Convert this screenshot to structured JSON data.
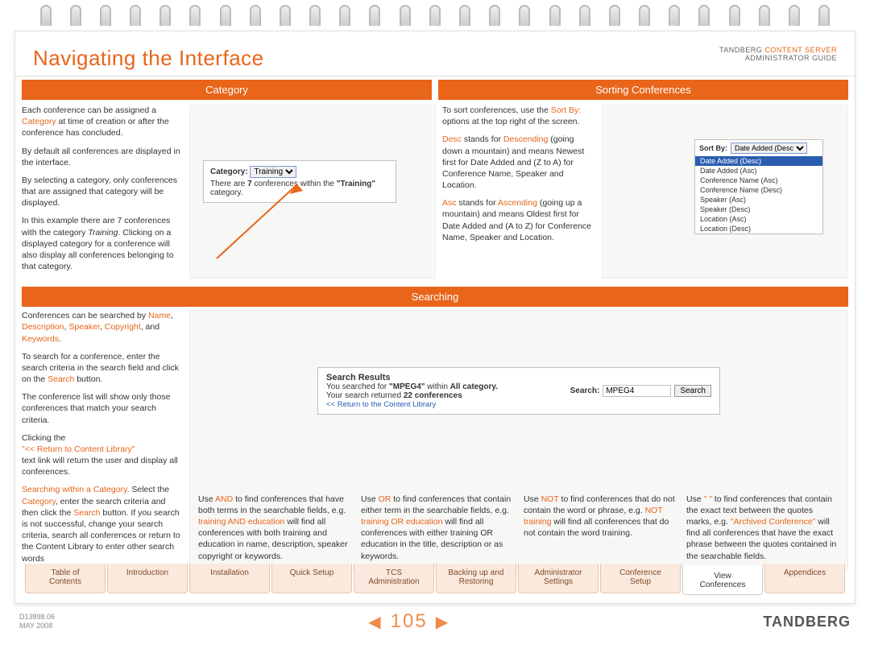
{
  "header": {
    "title": "Navigating the Interface",
    "brand_line1_a": "TANDBERG ",
    "brand_line1_b": "CONTENT SERVER",
    "brand_line2": "ADMINISTRATOR GUIDE"
  },
  "bars": {
    "category": "Category",
    "sorting": "Sorting Conferences",
    "searching": "Searching"
  },
  "category": {
    "p1a": "Each conference can be assigned a ",
    "p1b": "Category",
    "p1c": " at time of creation or after the conference has concluded.",
    "p2": "By default all conferences are displayed in the interface.",
    "p3": "By selecting a category, only conferences that are assigned that category will be displayed.",
    "p4a": "In this example there are 7 conferences with the category ",
    "p4b": "Training",
    "p4c": ". Clicking on a displayed category for a conference will also display all conferences belonging to that category.",
    "box_label": "Category:",
    "box_select": "Training",
    "box_sub_a": "There are ",
    "box_sub_b": "7",
    "box_sub_c": " conferences within the ",
    "box_sub_d": "\"Training\"",
    "box_sub_e": " category."
  },
  "sorting": {
    "p1a": "To sort conferences, use the ",
    "p1b": "Sort By:",
    "p1c": " options at the top right of the screen.",
    "p2a": "Desc",
    "p2b": " stands for ",
    "p2c": "Descending",
    "p2d": " (going down a mountain) and means Newest first for Date Added and (Z to A) for Conference Name, Speaker and Location.",
    "p3a": "Asc",
    "p3b": " stands for ",
    "p3c": "Ascending",
    "p3d": " (going up a mountain) and means Oldest first for Date Added and (A to Z) for Conference Name, Speaker and Location.",
    "box_label": "Sort By:",
    "box_selected": "Date Added (Desc)",
    "options": [
      "Date Added (Desc)",
      "Date Added (Asc)",
      "Conference Name (Asc)",
      "Conference Name (Desc)",
      "Speaker (Asc)",
      "Speaker (Desc)",
      "Location (Asc)",
      "Location (Desc)"
    ]
  },
  "searching": {
    "left": {
      "p1a": "Conferences can be searched by ",
      "p1b": "Name",
      "p1c": ", ",
      "p1d": "Description",
      "p1e": ", ",
      "p1f": "Speaker",
      "p1g": ", ",
      "p1h": "Copyright",
      "p1i": ", and ",
      "p1j": "Keywords",
      "p1k": ".",
      "p2a": "To search for a conference, enter the search criteria in the search field and click on the ",
      "p2b": "Search",
      "p2c": " button.",
      "p3": "The conference list will show only those conferences that match your search criteria.",
      "p4a": "Clicking the",
      "p4b": "\"<< Return to Content Library\"",
      "p4c": "text link will return the user and display all conferences.",
      "p5a": "Searching within a Category",
      "p5b": ". Select the ",
      "p5c": "Category",
      "p5d": ", enter the search criteria and then click the ",
      "p5e": "Search",
      "p5f": " button. If you search is not successful, change your search criteria, search all conferences or return to the Content Library to enter other search words"
    },
    "results": {
      "title": "Search Results",
      "line1a": "You searched for ",
      "line1b": "\"MPEG4\"",
      "line1c": " within ",
      "line1d": "All category.",
      "line2a": "Your search returned ",
      "line2b": "22 conferences",
      "return_link": "<< Return to the Content Library",
      "search_label": "Search:",
      "search_value": "MPEG4",
      "search_button": "Search"
    },
    "operators": {
      "and_a": "Use ",
      "and_b": "AND",
      "and_c": " to find conferences that have both terms in the searchable fields, e.g. ",
      "and_d": "training AND education",
      "and_e": " will find all conferences with both training and education in name, description, speaker copyright or keywords.",
      "or_a": "Use ",
      "or_b": "OR",
      "or_c": " to find conferences that contain either term in the searchable fields, e.g. ",
      "or_d": "training OR education",
      "or_e": " will find all conferences with either training OR education in the title, description or as keywords.",
      "not_a": "Use ",
      "not_b": "NOT",
      "not_c": " to find conferences that do not contain the word or phrase, e.g. ",
      "not_d": "NOT training",
      "not_e": " will find all conferences that do not contain the word training.",
      "q_a": "Use ",
      "q_b": "\" \"",
      "q_c": " to find conferences that contain the exact text between the quotes marks, e.g. ",
      "q_d": "\"Archived Conference\"",
      "q_e": " will find all conferences that have the exact phrase between the quotes contained in the searchable fields."
    }
  },
  "tabs": [
    {
      "label": "Table of\nContents"
    },
    {
      "label": "Introduction"
    },
    {
      "label": "Installation"
    },
    {
      "label": "Quick Setup"
    },
    {
      "label": "TCS\nAdministration"
    },
    {
      "label": "Backing up and\nRestoring"
    },
    {
      "label": "Administrator\nSettings"
    },
    {
      "label": "Conference\nSetup"
    },
    {
      "label": "View\nConferences",
      "active": true
    },
    {
      "label": "Appendices"
    }
  ],
  "footer": {
    "doc_id": "D13898.06",
    "date": "MAY 2008",
    "page": "105",
    "logo": "TANDBERG"
  }
}
